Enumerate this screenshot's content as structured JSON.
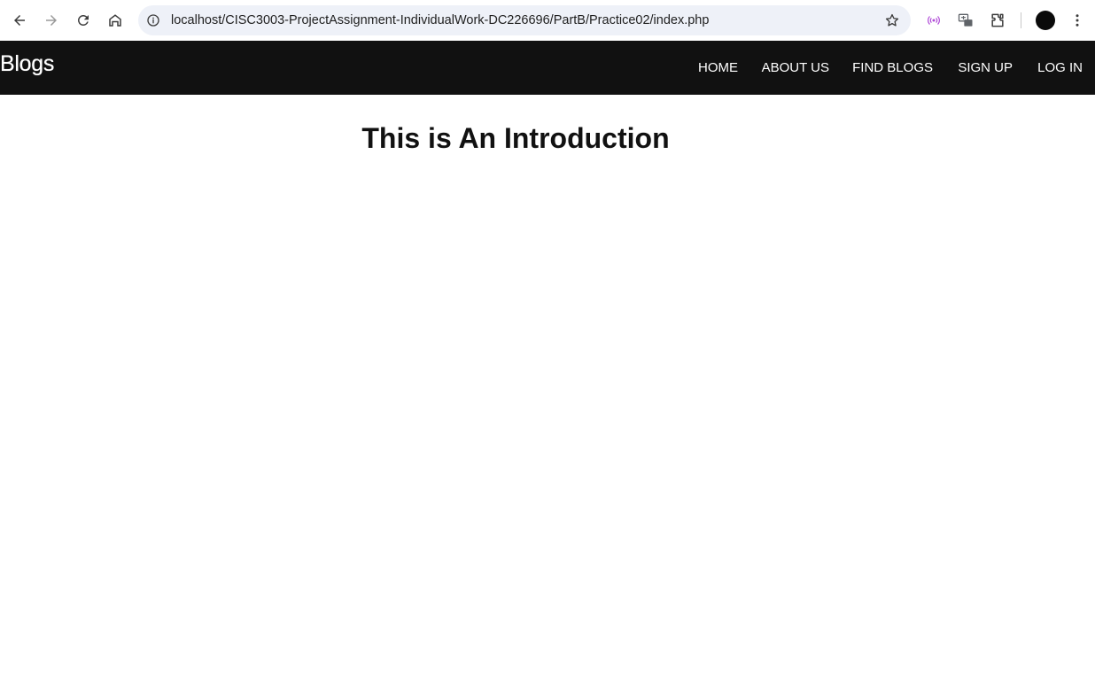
{
  "browser": {
    "url": "localhost/CISC3003-ProjectAssignment-IndividualWork-DC226696/PartB/Practice02/index.php",
    "icons": {
      "back": "arrow-left-icon",
      "forward": "arrow-right-icon",
      "reload": "reload-icon",
      "home": "home-icon",
      "site_info": "info-icon",
      "bookmark": "star-icon",
      "extension_1": "broadcast-icon",
      "extension_2": "translate-icon",
      "extensions": "puzzle-icon",
      "menu": "kebab-menu-icon"
    }
  },
  "header": {
    "brand": "Blogs",
    "nav": [
      {
        "label": "HOME"
      },
      {
        "label": "ABOUT US"
      },
      {
        "label": "FIND BLOGS"
      },
      {
        "label": "SIGN UP"
      },
      {
        "label": "LOG IN"
      }
    ]
  },
  "main": {
    "title": "This is An Introduction"
  },
  "colors": {
    "header_bg": "#111111",
    "header_text": "#ffffff",
    "omnibox_bg": "#eef1f8",
    "title_text": "#111111"
  }
}
